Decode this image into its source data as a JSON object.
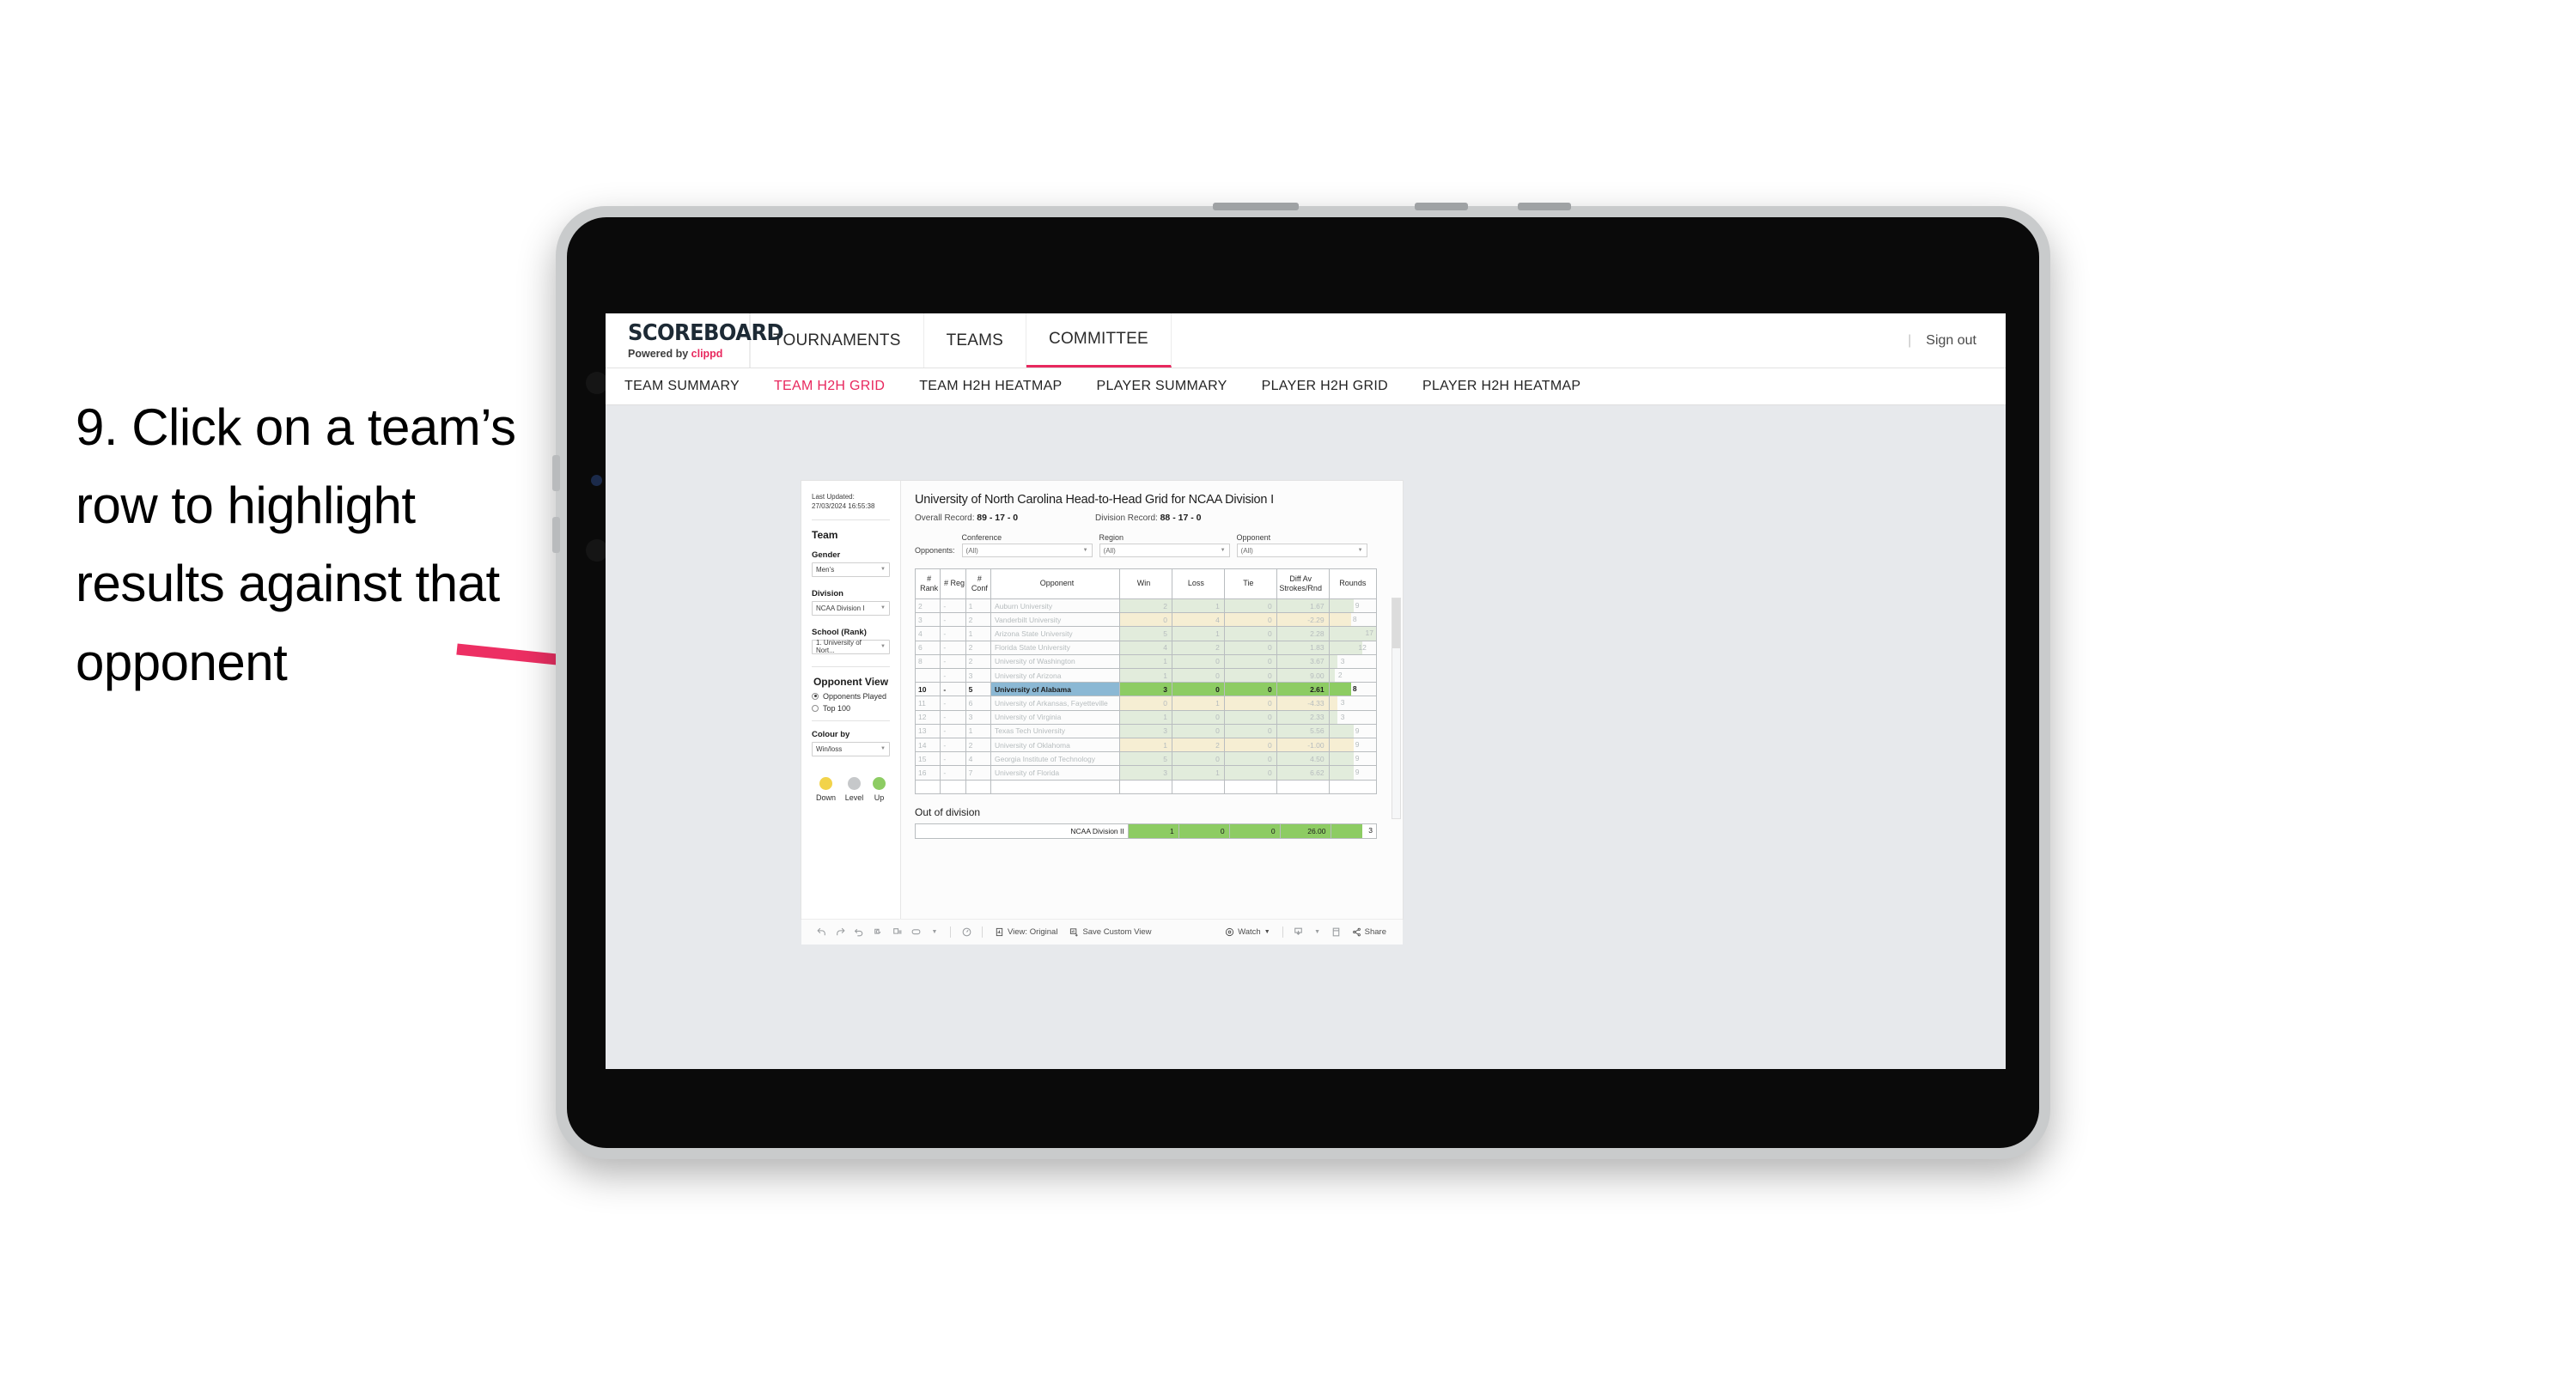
{
  "caption": {
    "text": "9. Click on a team’s row to highlight results against that opponent"
  },
  "topnav": {
    "brand_main": "SCOREBOARD",
    "brand_sub_prefix": "Powered by ",
    "brand_sub_accent": "clippd",
    "tabs": [
      {
        "label": "TOURNAMENTS",
        "active": false
      },
      {
        "label": "TEAMS",
        "active": false
      },
      {
        "label": "COMMITTEE",
        "active": true
      }
    ],
    "divider": "|",
    "signout": "Sign out"
  },
  "subnav": {
    "items": [
      {
        "label": "TEAM SUMMARY",
        "active": false
      },
      {
        "label": "TEAM H2H GRID",
        "active": true
      },
      {
        "label": "TEAM H2H HEATMAP",
        "active": false
      },
      {
        "label": "PLAYER SUMMARY",
        "active": false
      },
      {
        "label": "PLAYER H2H GRID",
        "active": false
      },
      {
        "label": "PLAYER H2H HEATMAP",
        "active": false
      }
    ]
  },
  "filters": {
    "last_updated": "Last Updated: 27/03/2024 16:55:38",
    "team_title": "Team",
    "gender_label": "Gender",
    "gender_value": "Men’s",
    "division_label": "Division",
    "division_value": "NCAA Division I",
    "school_label": "School (Rank)",
    "school_value": "1. University of Nort...",
    "opponent_view_title": "Opponent View",
    "radio_opponents_played": "Opponents Played",
    "radio_top100": "Top 100",
    "colour_by_label": "Colour by",
    "colour_by_value": "Win/loss",
    "legend": [
      {
        "label": "Down",
        "color": "#f5d košt"
      },
      {
        "label": "Level",
        "color": "#c6c8ca"
      },
      {
        "label": "Up",
        "color": "#8dcc63"
      }
    ],
    "legend_colors": {
      "down": "#f2d34a",
      "level": "#c6c8ca",
      "up": "#8dcc63"
    }
  },
  "main": {
    "title": "University of North Carolina Head-to-Head Grid for NCAA Division I",
    "overall_record_label": "Overall Record:",
    "overall_record_value": "89 - 17 - 0",
    "division_record_label": "Division Record:",
    "division_record_value": "88 - 17 - 0",
    "opponents_label": "Opponents:",
    "filter_fields": [
      {
        "label": "Conference",
        "value": "(All)"
      },
      {
        "label": "Region",
        "value": "(All)"
      },
      {
        "label": "Opponent",
        "value": "(All)"
      }
    ]
  },
  "chart_data": {
    "type": "table",
    "title": "University of North Carolina Head-to-Head Grid for NCAA Division I",
    "columns": [
      "# Rank",
      "# Reg",
      "# Conf",
      "Opponent",
      "Win",
      "Loss",
      "Tie",
      "Diff Av Strokes/Rnd",
      "Rounds"
    ],
    "selected_row_index": 6,
    "rows": [
      {
        "rank": "2",
        "reg": "-",
        "conf": "1",
        "opponent": "Auburn University",
        "win": "2",
        "loss": "1",
        "tie": "0",
        "diff": "1.67",
        "rounds": "9",
        "tone": "up",
        "selected": false
      },
      {
        "rank": "3",
        "reg": "-",
        "conf": "2",
        "opponent": "Vanderbilt University",
        "win": "0",
        "loss": "4",
        "tie": "0",
        "diff": "-2.29",
        "rounds": "8",
        "tone": "down",
        "selected": false
      },
      {
        "rank": "4",
        "reg": "-",
        "conf": "1",
        "opponent": "Arizona State University",
        "win": "5",
        "loss": "1",
        "tie": "0",
        "diff": "2.28",
        "rounds": "17",
        "tone": "up",
        "selected": false
      },
      {
        "rank": "6",
        "reg": "-",
        "conf": "2",
        "opponent": "Florida State University",
        "win": "4",
        "loss": "2",
        "tie": "0",
        "diff": "1.83",
        "rounds": "12",
        "tone": "up",
        "selected": false
      },
      {
        "rank": "8",
        "reg": "-",
        "conf": "2",
        "opponent": "University of Washington",
        "win": "1",
        "loss": "0",
        "tie": "0",
        "diff": "3.67",
        "rounds": "3",
        "tone": "up",
        "selected": false
      },
      {
        "rank": "",
        "reg": "-",
        "conf": "3",
        "opponent": "University of Arizona",
        "win": "1",
        "loss": "0",
        "tie": "0",
        "diff": "9.00",
        "rounds": "2",
        "tone": "up",
        "selected": false
      },
      {
        "rank": "10",
        "reg": "-",
        "conf": "5",
        "opponent": "University of Alabama",
        "win": "3",
        "loss": "0",
        "tie": "0",
        "diff": "2.61",
        "rounds": "8",
        "tone": "up",
        "selected": true
      },
      {
        "rank": "11",
        "reg": "-",
        "conf": "6",
        "opponent": "University of Arkansas, Fayetteville",
        "win": "0",
        "loss": "1",
        "tie": "0",
        "diff": "-4.33",
        "rounds": "3",
        "tone": "down",
        "selected": false
      },
      {
        "rank": "12",
        "reg": "-",
        "conf": "3",
        "opponent": "University of Virginia",
        "win": "1",
        "loss": "0",
        "tie": "0",
        "diff": "2.33",
        "rounds": "3",
        "tone": "up",
        "selected": false
      },
      {
        "rank": "13",
        "reg": "-",
        "conf": "1",
        "opponent": "Texas Tech University",
        "win": "3",
        "loss": "0",
        "tie": "0",
        "diff": "5.56",
        "rounds": "9",
        "tone": "up",
        "selected": false
      },
      {
        "rank": "14",
        "reg": "-",
        "conf": "2",
        "opponent": "University of Oklahoma",
        "win": "1",
        "loss": "2",
        "tie": "0",
        "diff": "-1.00",
        "rounds": "9",
        "tone": "down",
        "selected": false
      },
      {
        "rank": "15",
        "reg": "-",
        "conf": "4",
        "opponent": "Georgia Institute of Technology",
        "win": "5",
        "loss": "0",
        "tie": "0",
        "diff": "4.50",
        "rounds": "9",
        "tone": "up",
        "selected": false
      },
      {
        "rank": "16",
        "reg": "-",
        "conf": "7",
        "opponent": "University of Florida",
        "win": "3",
        "loss": "1",
        "tie": "0",
        "diff": "6.62",
        "rounds": "9",
        "tone": "up",
        "selected": false
      }
    ],
    "rounds_max": 17,
    "colors": {
      "up_fill": "#e2ecdc",
      "down_fill": "#f6eed3",
      "up_strong": "#8dcc63",
      "selected_row": "#8bb8d4"
    }
  },
  "out_of_division": {
    "title": "Out of division",
    "row": {
      "name": "NCAA Division II",
      "win": "1",
      "loss": "0",
      "tie": "0",
      "diff": "26.00",
      "rounds": "3"
    }
  },
  "toolbar": {
    "icons": [
      "undo-icon",
      "redo-icon",
      "revert-icon",
      "refresh-icon",
      "pause-icon",
      "rectangle-select-icon",
      "dropdown-caret-icon",
      "speed-icon"
    ],
    "view_label": "View: Original",
    "save_label": "Save Custom View",
    "watch_label": "Watch",
    "share_label": "Share"
  }
}
